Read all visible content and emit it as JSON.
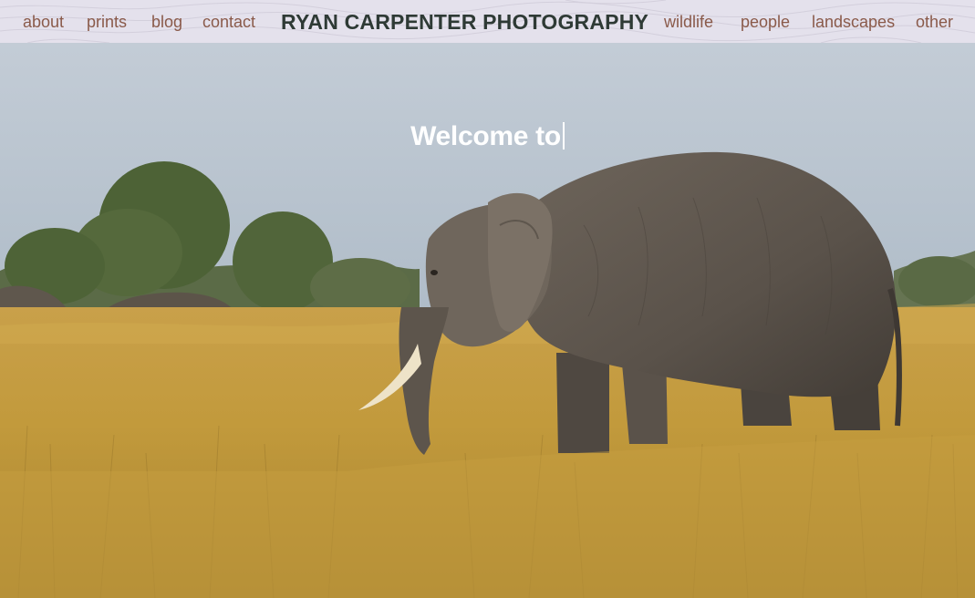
{
  "nav": {
    "left_links": [
      "about",
      "prints",
      "blog",
      "contact"
    ],
    "right_links": [
      "wildlife",
      "people",
      "landscapes",
      "other"
    ],
    "site_title": "RYAN CARPENTER PHOTOGRAPHY"
  },
  "hero": {
    "headline": "Welcome to",
    "image_alt_subject": "elephant in golden savanna grass"
  },
  "colors": {
    "nav_background": "#e4e1ec",
    "nav_link": "#8a5a4a",
    "site_title": "#2e3a35",
    "sky": "#b6c2cd",
    "grass": "#c29a3e",
    "headline": "#ffffff"
  }
}
